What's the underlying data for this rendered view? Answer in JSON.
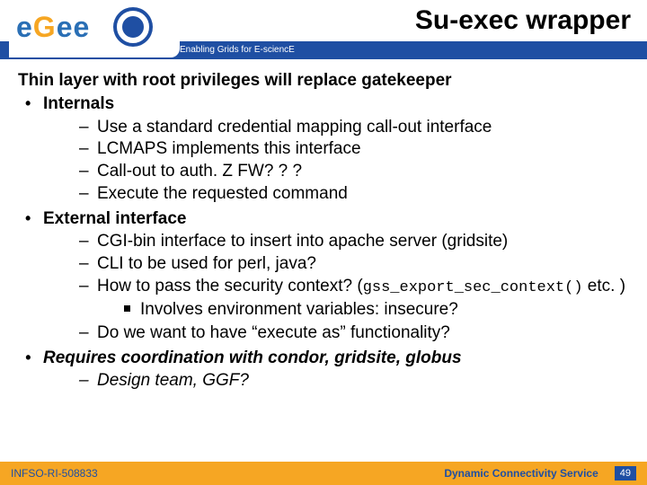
{
  "header": {
    "title": "Su-exec wrapper",
    "tagline": "Enabling Grids for E-sciencE",
    "logo_text_parts": {
      "a": "e",
      "b": "G",
      "c": "ee"
    }
  },
  "content": {
    "lead": "Thin layer with root privileges will replace gatekeeper",
    "bullets": [
      {
        "label": "Internals",
        "dashes": [
          "Use a standard credential mapping call-out interface",
          "LCMAPS implements this interface",
          "Call-out to auth. Z FW? ? ?",
          "Execute the requested command"
        ]
      },
      {
        "label": "External interface",
        "dashes_ext": true
      },
      {
        "label": "Requires coordination with condor, gridsite, globus",
        "italic": true,
        "dashes_italic": [
          "Design team, GGF?"
        ]
      }
    ],
    "ext": {
      "d1": "CGI-bin interface to insert into apache server (gridsite)",
      "d2": "CLI to be used for perl, java?",
      "d3_a": "How to pass the security context? (",
      "d3_code": "gss_export_sec_context()",
      "d3_b": " etc. )",
      "sq": "Involves environment variables: insecure?",
      "d4": "Do we want to have “execute as” functionality?"
    }
  },
  "footer": {
    "left": "INFSO-RI-508833",
    "right": "Dynamic Connectivity Service",
    "page": "49"
  }
}
